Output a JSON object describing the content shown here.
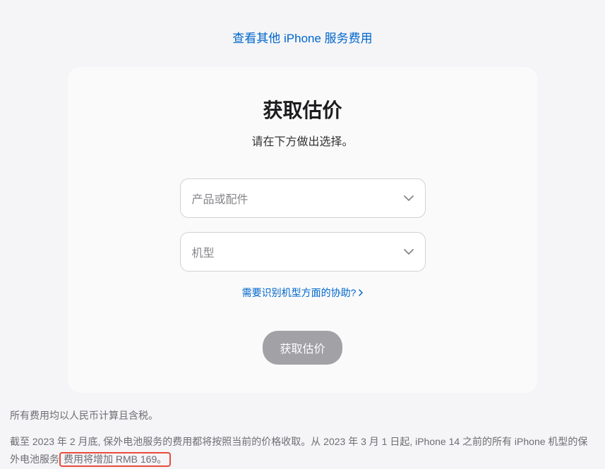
{
  "topLink": "查看其他 iPhone 服务费用",
  "card": {
    "title": "获取估价",
    "subtitle": "请在下方做出选择。",
    "select1": "产品或配件",
    "select2": "机型",
    "helpLink": "需要识别机型方面的协助?",
    "submitBtn": "获取估价"
  },
  "footer": {
    "line1": "所有费用均以人民币计算且含税。",
    "line2_part1": "截至 2023 年 2 月底, 保外电池服务的费用都将按照当前的价格收取。从 2023 年 3 月 1 日起, iPhone 14 之前的所有 iPhone 机型的保外电池服务",
    "line2_highlight": "费用将增加 RMB 169。"
  }
}
